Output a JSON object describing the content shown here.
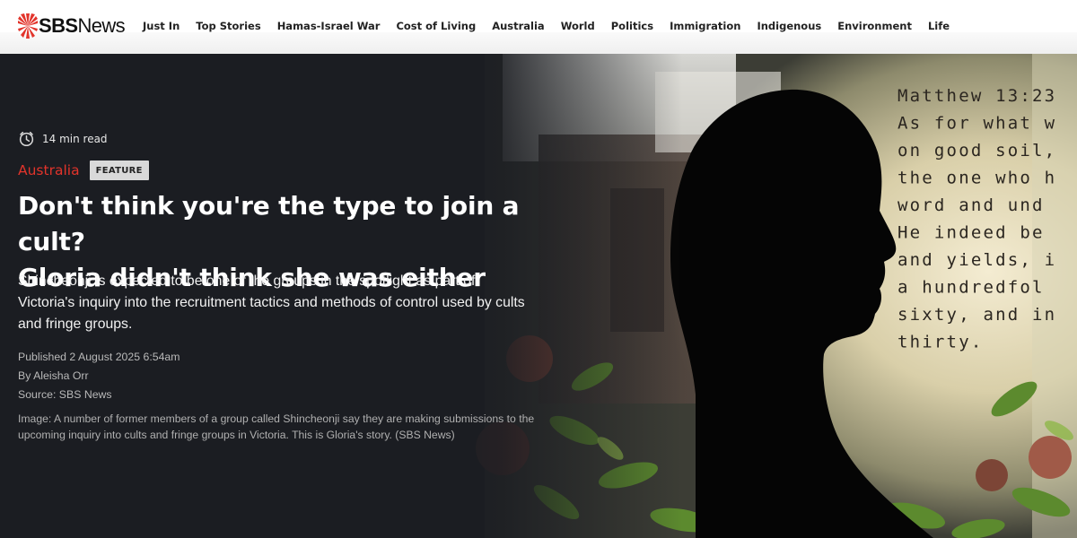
{
  "brand": {
    "logo_bold": "SBS",
    "logo_light": "News",
    "accent": "#e2342b"
  },
  "nav": {
    "items": [
      {
        "label": "Just In"
      },
      {
        "label": "Top Stories"
      },
      {
        "label": "Hamas-Israel War"
      },
      {
        "label": "Cost of Living"
      },
      {
        "label": "Australia"
      },
      {
        "label": "World"
      },
      {
        "label": "Politics"
      },
      {
        "label": "Immigration"
      },
      {
        "label": "Indigenous"
      },
      {
        "label": "Environment"
      },
      {
        "label": "Life"
      }
    ]
  },
  "article": {
    "read_time": "14 min read",
    "read_time_icon": "clock-icon",
    "category": "Australia",
    "badge": "FEATURE",
    "headline_line1": "Don't think you're the type to join a cult?",
    "headline_line2": "Gloria didn't think she was either",
    "standfirst": "Shincheonji is expected to be one of the groups in the spotlight as part of Victoria's inquiry into the recruitment tactics and methods of control used by cults and fringe groups.",
    "published": "Published 2 August 2025 6:54am",
    "byline": "By Aleisha Orr",
    "source": "Source: SBS News",
    "image_caption": "Image: A number of former members of a group called Shincheonji say they are making submissions to the upcoming inquiry into cults and fringe groups in Victoria. This is Gloria's story. (SBS News)"
  },
  "hero_image": {
    "scripture_lines": [
      "Matthew 13:23",
      "As for what w",
      "on good soil,",
      "the one who h",
      "word and und",
      "He indeed be",
      "and yields, i",
      "a hundredfol",
      "sixty, and in",
      "thirty."
    ]
  }
}
